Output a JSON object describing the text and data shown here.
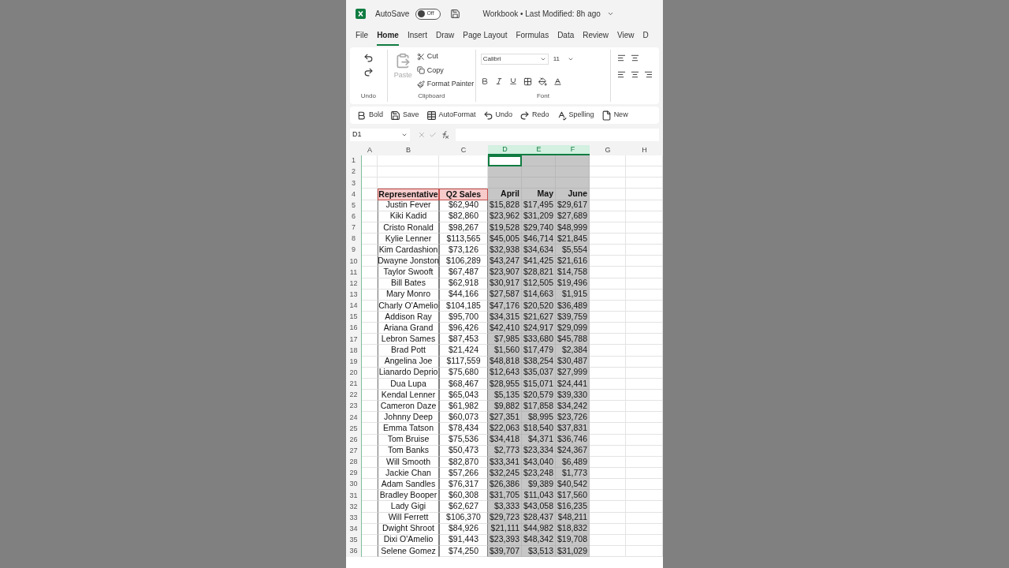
{
  "title_bar": {
    "autosave_label": "AutoSave",
    "autosave_toggle": {
      "label": "Off",
      "on": false
    },
    "title": "Workbook • Last Modified: 8h ago"
  },
  "menu_tabs": [
    {
      "label": "File",
      "selected": false
    },
    {
      "label": "Home",
      "selected": true
    },
    {
      "label": "Insert",
      "selected": false
    },
    {
      "label": "Draw",
      "selected": false
    },
    {
      "label": "Page Layout",
      "selected": false
    },
    {
      "label": "Formulas",
      "selected": false
    },
    {
      "label": "Data",
      "selected": false
    },
    {
      "label": "Review",
      "selected": false
    },
    {
      "label": "View",
      "selected": false
    },
    {
      "label": "D",
      "selected": false
    }
  ],
  "ribbon": {
    "undo_group": {
      "label": "Undo"
    },
    "clipboard": {
      "paste": {
        "label": "Paste",
        "disabled": true
      },
      "cut": "Cut",
      "copy": "Copy",
      "format_painter": "Format Painter",
      "label": "Clipboard"
    },
    "font": {
      "font_name": "Calibri",
      "font_size": "11",
      "label": "Font"
    }
  },
  "quick_access": [
    {
      "kind": "bold",
      "label": "Bold"
    },
    {
      "kind": "save",
      "label": "Save"
    },
    {
      "kind": "autoformat",
      "label": "AutoFormat"
    },
    {
      "kind": "undo",
      "label": "Undo"
    },
    {
      "kind": "redo",
      "label": "Redo"
    },
    {
      "kind": "spelling",
      "label": "Spelling"
    },
    {
      "kind": "new",
      "label": "New"
    }
  ],
  "formula_bar": {
    "name_box": "D1"
  },
  "columns": [
    {
      "letter": "A",
      "selected": false,
      "active": false
    },
    {
      "letter": "B",
      "selected": false,
      "active": false
    },
    {
      "letter": "C",
      "selected": false,
      "active": false
    },
    {
      "letter": "D",
      "selected": true,
      "active": true
    },
    {
      "letter": "E",
      "selected": true,
      "active": false
    },
    {
      "letter": "F",
      "selected": true,
      "active": false
    },
    {
      "letter": "G",
      "selected": false,
      "active": false
    },
    {
      "letter": "H",
      "selected": false,
      "active": false
    }
  ],
  "rows": [
    {
      "number": "1",
      "kind": "blank"
    },
    {
      "number": "2",
      "kind": "blank"
    },
    {
      "number": "3",
      "kind": "blank"
    },
    {
      "number": "4",
      "kind": "header",
      "representative": "Representative",
      "q2_sales": "Q2 Sales",
      "april": "April",
      "may": "May",
      "june": "June"
    },
    {
      "number": "5",
      "kind": "data",
      "representative": "Justin Fever",
      "q2_sales": "$62,940",
      "april": "$15,828",
      "may": "$17,495",
      "june": "$29,617"
    },
    {
      "number": "6",
      "kind": "data",
      "representative": "Kiki Kadid",
      "q2_sales": "$82,860",
      "april": "$23,962",
      "may": "$31,209",
      "june": "$27,689"
    },
    {
      "number": "7",
      "kind": "data",
      "representative": "Cristo Ronald",
      "q2_sales": "$98,267",
      "april": "$19,528",
      "may": "$29,740",
      "june": "$48,999"
    },
    {
      "number": "8",
      "kind": "data",
      "representative": "Kylie Lenner",
      "q2_sales": "$113,565",
      "april": "$45,005",
      "may": "$46,714",
      "june": "$21,845"
    },
    {
      "number": "9",
      "kind": "data",
      "representative": "Kim Cardashion",
      "q2_sales": "$73,126",
      "april": "$32,938",
      "may": "$34,634",
      "june": "$5,554"
    },
    {
      "number": "10",
      "kind": "data",
      "representative": "Dwayne Jonston",
      "q2_sales": "$106,289",
      "april": "$43,247",
      "may": "$41,425",
      "june": "$21,616"
    },
    {
      "number": "11",
      "kind": "data",
      "representative": "Taylor Swooft",
      "q2_sales": "$67,487",
      "april": "$23,907",
      "may": "$28,821",
      "june": "$14,758"
    },
    {
      "number": "12",
      "kind": "data",
      "representative": "Bill Bates",
      "q2_sales": "$62,918",
      "april": "$30,917",
      "may": "$12,505",
      "june": "$19,496"
    },
    {
      "number": "13",
      "kind": "data",
      "representative": "Mary Monro",
      "q2_sales": "$44,166",
      "april": "$27,587",
      "may": "$14,663",
      "june": "$1,915"
    },
    {
      "number": "14",
      "kind": "data",
      "representative": "Charly O'Amelio",
      "q2_sales": "$104,185",
      "april": "$47,176",
      "may": "$20,520",
      "june": "$36,489"
    },
    {
      "number": "15",
      "kind": "data",
      "representative": "Addison Ray",
      "q2_sales": "$95,700",
      "april": "$34,315",
      "may": "$21,627",
      "june": "$39,759"
    },
    {
      "number": "16",
      "kind": "data",
      "representative": "Ariana Grand",
      "q2_sales": "$96,426",
      "april": "$42,410",
      "may": "$24,917",
      "june": "$29,099"
    },
    {
      "number": "17",
      "kind": "data",
      "representative": "Lebron Sames",
      "q2_sales": "$87,453",
      "april": "$7,985",
      "may": "$33,680",
      "june": "$45,788"
    },
    {
      "number": "18",
      "kind": "data",
      "representative": "Brad Pott",
      "q2_sales": "$21,424",
      "april": "$1,560",
      "may": "$17,479",
      "june": "$2,384"
    },
    {
      "number": "19",
      "kind": "data",
      "representative": "Angelina Joe",
      "q2_sales": "$117,559",
      "april": "$48,818",
      "may": "$38,254",
      "june": "$30,487"
    },
    {
      "number": "20",
      "kind": "data",
      "representative": "Lianardo Deprio",
      "q2_sales": "$75,680",
      "april": "$12,643",
      "may": "$35,037",
      "june": "$27,999"
    },
    {
      "number": "21",
      "kind": "data",
      "representative": "Dua Lupa",
      "q2_sales": "$68,467",
      "april": "$28,955",
      "may": "$15,071",
      "june": "$24,441"
    },
    {
      "number": "22",
      "kind": "data",
      "representative": "Kendal Lenner",
      "q2_sales": "$65,043",
      "april": "$5,135",
      "may": "$20,579",
      "june": "$39,330"
    },
    {
      "number": "23",
      "kind": "data",
      "representative": "Cameron Daze",
      "q2_sales": "$61,982",
      "april": "$9,882",
      "may": "$17,858",
      "june": "$34,242"
    },
    {
      "number": "24",
      "kind": "data",
      "representative": "Johnny Deep",
      "q2_sales": "$60,073",
      "april": "$27,351",
      "may": "$8,995",
      "june": "$23,726"
    },
    {
      "number": "25",
      "kind": "data",
      "representative": "Emma Tatson",
      "q2_sales": "$78,434",
      "april": "$22,063",
      "may": "$18,540",
      "june": "$37,831"
    },
    {
      "number": "26",
      "kind": "data",
      "representative": "Tom Bruise",
      "q2_sales": "$75,536",
      "april": "$34,418",
      "may": "$4,371",
      "june": "$36,746"
    },
    {
      "number": "27",
      "kind": "data",
      "representative": "Tom Banks",
      "q2_sales": "$50,473",
      "april": "$2,773",
      "may": "$23,334",
      "june": "$24,367"
    },
    {
      "number": "28",
      "kind": "data",
      "representative": "Will Smooth",
      "q2_sales": "$82,870",
      "april": "$33,341",
      "may": "$43,040",
      "june": "$6,489"
    },
    {
      "number": "29",
      "kind": "data",
      "representative": "Jackie Chan",
      "q2_sales": "$57,266",
      "april": "$32,245",
      "may": "$23,248",
      "june": "$1,773"
    },
    {
      "number": "30",
      "kind": "data",
      "representative": "Adam Sandles",
      "q2_sales": "$76,317",
      "april": "$26,386",
      "may": "$9,389",
      "june": "$40,542"
    },
    {
      "number": "31",
      "kind": "data",
      "representative": "Bradley Booper",
      "q2_sales": "$60,308",
      "april": "$31,705",
      "may": "$11,043",
      "june": "$17,560"
    },
    {
      "number": "32",
      "kind": "data",
      "representative": "Lady Gigi",
      "q2_sales": "$62,627",
      "april": "$3,333",
      "may": "$43,058",
      "june": "$16,235"
    },
    {
      "number": "33",
      "kind": "data",
      "representative": "Will Ferrett",
      "q2_sales": "$106,370",
      "april": "$29,723",
      "may": "$28,437",
      "june": "$48,211"
    },
    {
      "number": "34",
      "kind": "data",
      "representative": "Dwight Shroot",
      "q2_sales": "$84,926",
      "april": "$21,111",
      "may": "$44,982",
      "june": "$18,832"
    },
    {
      "number": "35",
      "kind": "data",
      "representative": "Dixi O'Amelio",
      "q2_sales": "$91,443",
      "april": "$23,393",
      "may": "$48,342",
      "june": "$19,708"
    },
    {
      "number": "36",
      "kind": "data",
      "representative": "Selene Gomez",
      "q2_sales": "$74,250",
      "april": "$39,707",
      "may": "$3,513",
      "june": "$31,029"
    }
  ]
}
